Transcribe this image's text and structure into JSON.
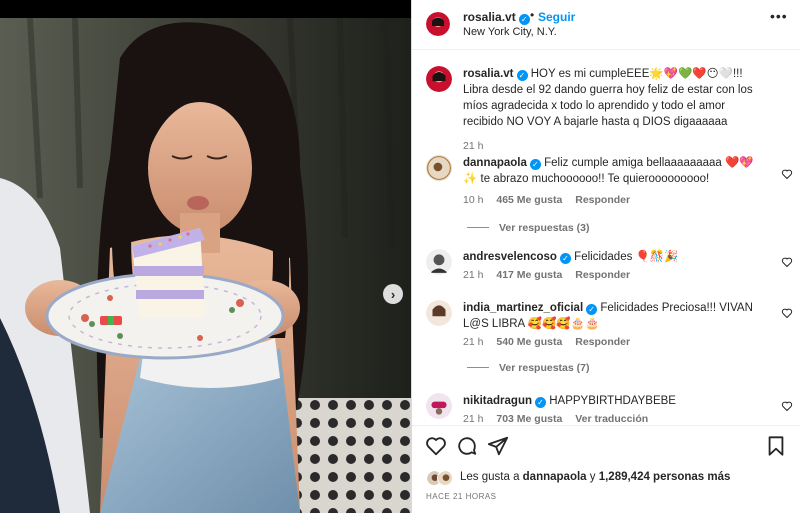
{
  "post": {
    "username": "rosalia.vt",
    "follow_label": "Seguir",
    "location": "New York City, N.Y.",
    "separator": "•",
    "more_glyph": "•••"
  },
  "caption": {
    "username": "rosalia.vt",
    "text": "HOY es mi cumpleEEE🌟💖💚❤️😶🤍!!! Libra desde el 92 dando guerra hoy feliz de estar con los míos agradecida x todo lo aprendido y todo el amor recibido NO VOY A bajarle hasta q DIOS digaaaaaa",
    "time": "21 h"
  },
  "comments": [
    {
      "username": "dannapaola",
      "text": "Feliz cumple amiga bellaaaaaaaaa ❤️💖✨ te abrazo muchoooooo!! Te quierooooooooo!",
      "time": "10 h",
      "likes": "465 Me gusta",
      "reply_label": "Responder",
      "view_replies": "Ver respuestas (3)"
    },
    {
      "username": "andresvelencoso",
      "text": "Felicidades 🎈🎊🎉",
      "time": "21 h",
      "likes": "417 Me gusta",
      "reply_label": "Responder"
    },
    {
      "username": "india_martinez_oficial",
      "text": "Felicidades Preciosa!!! VIVAN L@S LIBRA 🥰🥰🥰🎂🎂",
      "time": "21 h",
      "likes": "540 Me gusta",
      "reply_label": "Responder",
      "view_replies": "Ver respuestas (7)"
    },
    {
      "username": "nikitadragun",
      "text": "HAPPYBIRTHDAYBEBE",
      "time": "21 h",
      "likes": "703 Me gusta",
      "reply_label": "Ver traducción"
    }
  ],
  "likes": {
    "prefix": "Les gusta a ",
    "user": "dannapaola",
    "connector": " y ",
    "count": "1,289,424 personas más"
  },
  "post_age": "HACE 21 HORAS",
  "icons": {
    "more": "more-horizontal-icon",
    "like": "heart-icon",
    "comment": "comment-icon",
    "share": "send-icon",
    "save": "bookmark-icon",
    "next": "chevron-right-icon",
    "verified": "verified-badge-icon"
  },
  "colors": {
    "accent": "#0095f6",
    "text": "#262626",
    "muted": "#737373",
    "verified": "#0095f6"
  }
}
